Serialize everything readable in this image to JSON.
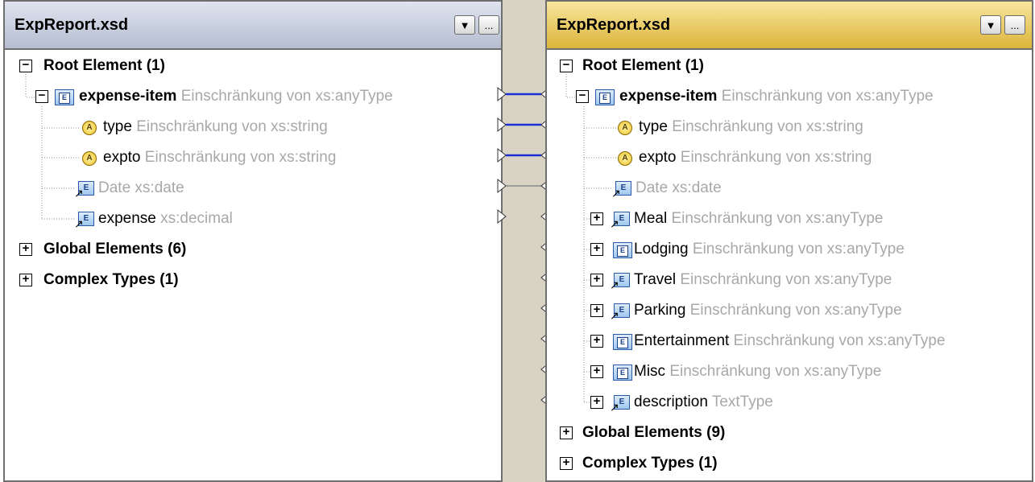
{
  "left": {
    "title": "ExpReport.xsd",
    "dropdown_glyph": "▼",
    "more_glyph": "...",
    "tree": [
      {
        "toggle": "−",
        "name": "Root Element (1)",
        "type": ""
      },
      {
        "toggle": "−",
        "name": "expense-item",
        "type": "Einschränkung von xs:anyType"
      },
      {
        "name": "type",
        "type": "Einschränkung von xs:string"
      },
      {
        "name": "expto",
        "type": "Einschränkung von xs:string"
      },
      {
        "name": "Date",
        "type": "Date xs:date"
      },
      {
        "name": "expense",
        "type": "xs:decimal"
      },
      {
        "toggle": "+",
        "name": "Global Elements (6)"
      },
      {
        "toggle": "+",
        "name": "Complex Types (1)"
      }
    ]
  },
  "right": {
    "title": "ExpReport.xsd",
    "dropdown_glyph": "▼",
    "more_glyph": "...",
    "tree": [
      {
        "toggle": "−",
        "name": "Root Element (1)"
      },
      {
        "toggle": "−",
        "name": "expense-item",
        "type": "Einschränkung von xs:anyType"
      },
      {
        "name": "type",
        "type": "Einschränkung von xs:string"
      },
      {
        "name": "expto",
        "type": "Einschränkung von xs:string"
      },
      {
        "name": "Date",
        "type": "Date xs:date"
      },
      {
        "toggle": "+",
        "name": "Meal",
        "type": "Einschränkung von xs:anyType"
      },
      {
        "toggle": "+",
        "name": "Lodging",
        "type": "Einschränkung von xs:anyType"
      },
      {
        "toggle": "+",
        "name": "Travel",
        "type": "Einschränkung von xs:anyType"
      },
      {
        "toggle": "+",
        "name": "Parking",
        "type": "Einschränkung von xs:anyType"
      },
      {
        "toggle": "+",
        "name": "Entertainment",
        "type": "Einschränkung von xs:anyType"
      },
      {
        "toggle": "+",
        "name": "Misc",
        "type": "Einschränkung von xs:anyType"
      },
      {
        "toggle": "+",
        "name": "description",
        "type": "TextType"
      },
      {
        "toggle": "+",
        "name": "Global Elements (9)"
      },
      {
        "toggle": "+",
        "name": "Complex Types (1)"
      }
    ]
  },
  "icons": {
    "element": "element-icon",
    "element_reference": "element-reference-icon",
    "attribute": "attribute-icon",
    "expand": "expand-icon",
    "collapse": "collapse-icon"
  },
  "connections": [
    {
      "from": "expense-item",
      "to": "expense-item",
      "color": "#1a2fd6"
    },
    {
      "from": "type",
      "to": "type",
      "color": "#1a2fd6"
    },
    {
      "from": "expto",
      "to": "expto",
      "color": "#1a2fd6"
    },
    {
      "from": "Date",
      "to": "Date",
      "color": "#8a8a8a"
    }
  ],
  "colors": {
    "left_header": "#c8cfe0",
    "right_header": "#f2d663",
    "type_text": "#a8a8a8",
    "connection": "#1a2fd6"
  }
}
